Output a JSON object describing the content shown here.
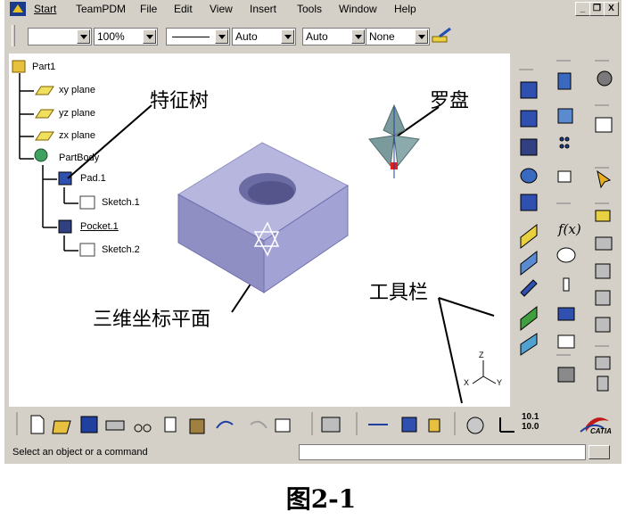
{
  "menu": {
    "start": "Start",
    "teampdm": "TeamPDM",
    "file": "File",
    "edit": "Edit",
    "view": "View",
    "insert": "Insert",
    "tools": "Tools",
    "window": "Window",
    "help": "Help"
  },
  "window_controls": {
    "minimize": "_",
    "restore": "❐",
    "close": "X"
  },
  "toolbar": {
    "color_value": "",
    "zoom_value": "100%",
    "line_value": "",
    "auto1_value": "Auto",
    "auto2_value": "Auto",
    "none_value": "None"
  },
  "tree": {
    "root": "Part1",
    "xy": "xy plane",
    "yz": "yz plane",
    "zx": "zx plane",
    "body": "PartBody",
    "pad": "Pad.1",
    "sketch1": "Sketch.1",
    "pocket": "Pocket.1",
    "sketch2": "Sketch.2"
  },
  "annotations": {
    "tree": "特征树",
    "compass": "罗盘",
    "toolbar": "工具栏",
    "plane": "三维坐标平面"
  },
  "axes": {
    "z": "Z",
    "x": "X",
    "y": "Y"
  },
  "bottom_bar": {
    "scale_top": "10.1",
    "scale_bottom": "10.0",
    "brand": "CATIA"
  },
  "status": {
    "message": "Select an object or a command"
  },
  "caption": "图2-1",
  "colors": {
    "chrome": "#d4d0c8",
    "solid_top": "#b6b6de",
    "solid_front": "#8f8fc4",
    "solid_side": "#a2a2d4",
    "compass": "#7a9a9c"
  }
}
